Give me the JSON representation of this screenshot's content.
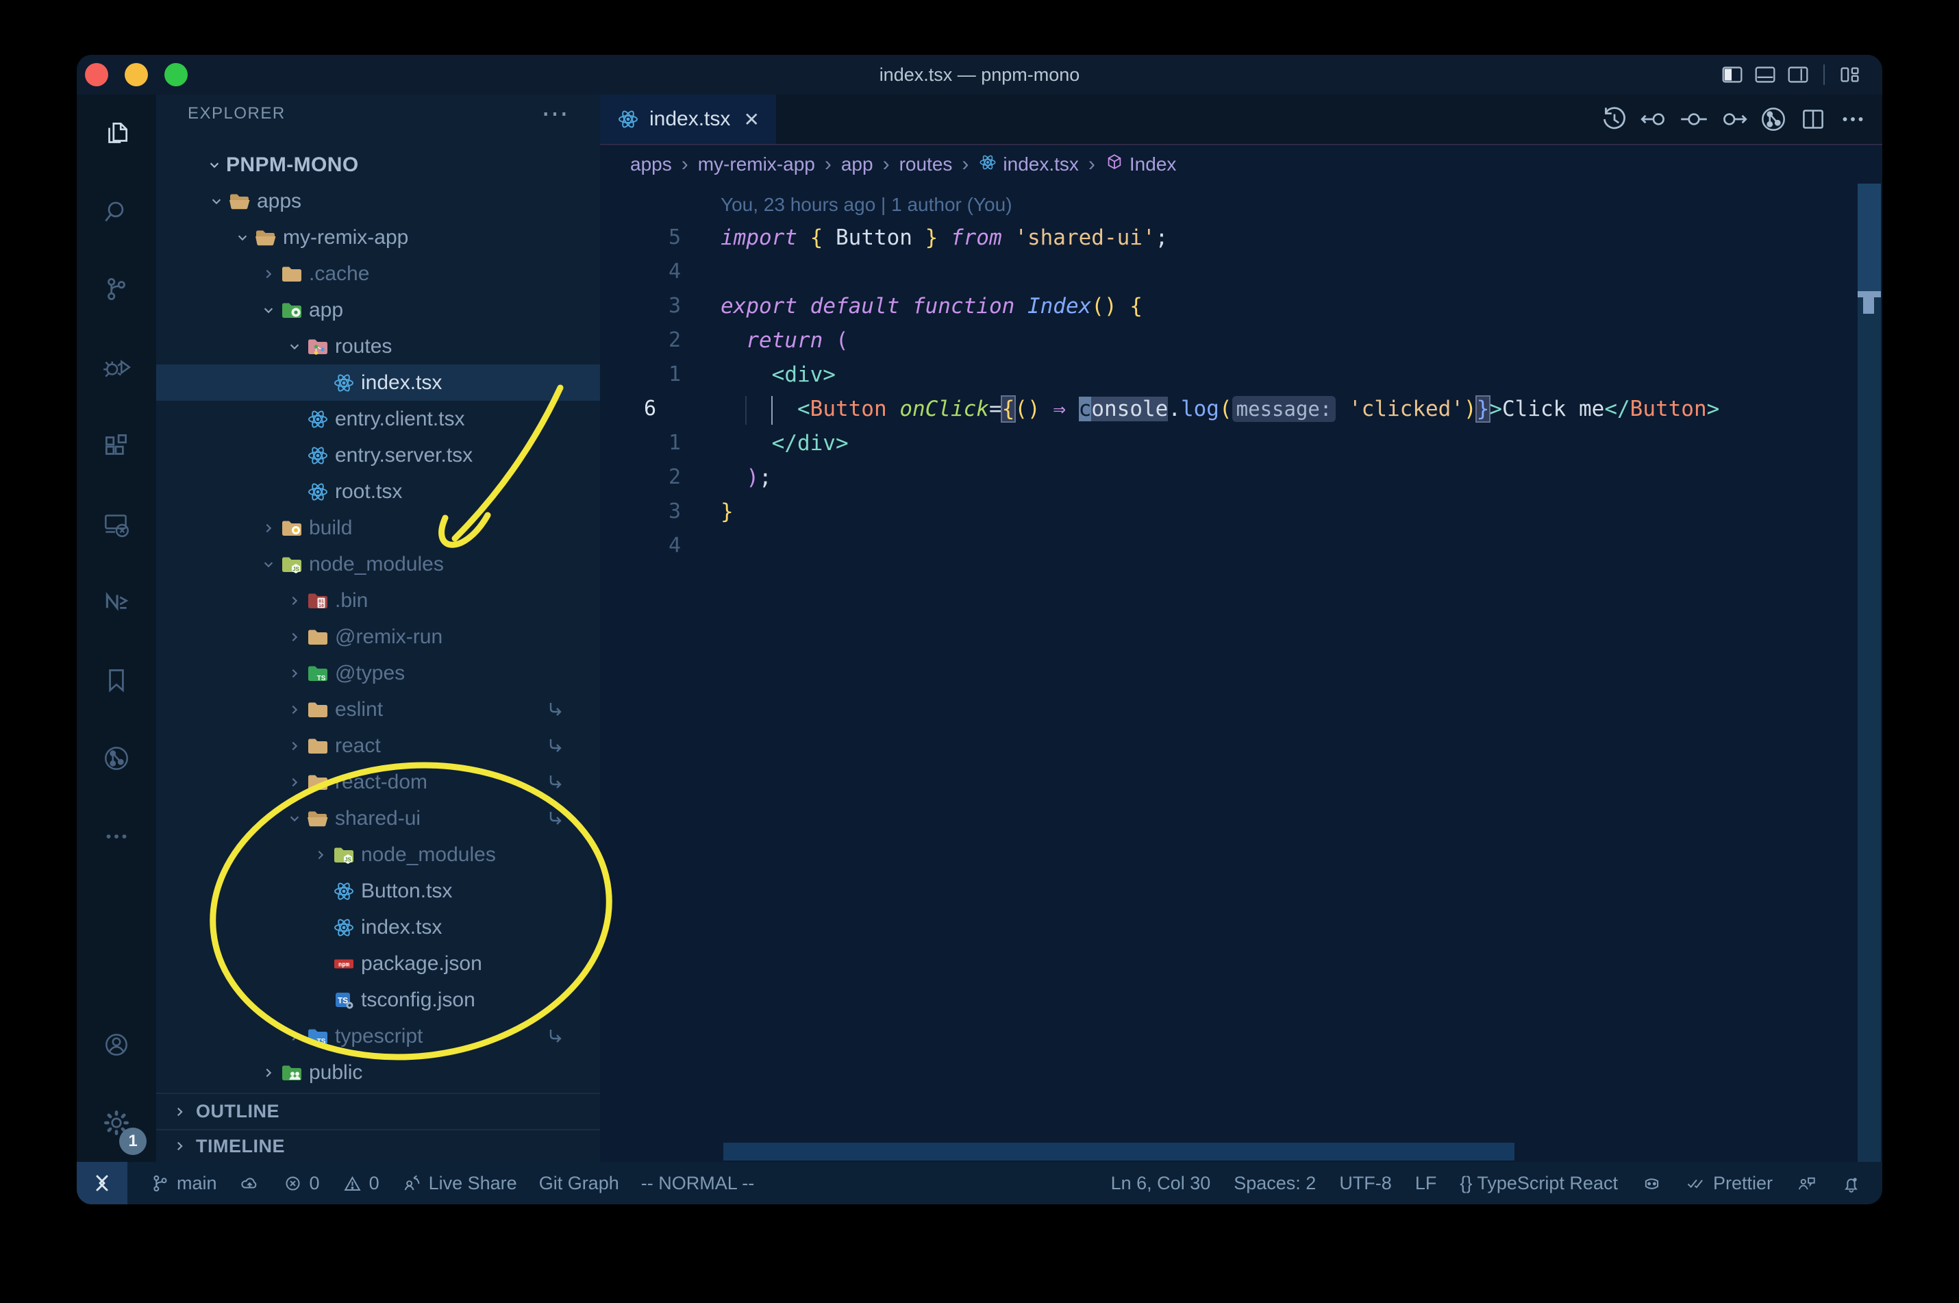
{
  "window": {
    "title": "index.tsx — pnpm-mono",
    "controls": [
      {
        "name": "close",
        "color": "#f5605a"
      },
      {
        "name": "minimize",
        "color": "#f6bd3e"
      },
      {
        "name": "zoom",
        "color": "#31c748"
      }
    ],
    "layout_icons": [
      "panel-left",
      "panel-bottom",
      "panel-right",
      "|",
      "layout"
    ]
  },
  "activity_bar": {
    "top": [
      {
        "name": "explorer",
        "icon": "files",
        "active": true
      },
      {
        "name": "search",
        "icon": "search"
      },
      {
        "name": "source-control",
        "icon": "scm"
      },
      {
        "name": "run-and-debug",
        "icon": "debug"
      },
      {
        "name": "extensions",
        "icon": "extensions"
      },
      {
        "name": "remote-explorer",
        "icon": "remote"
      },
      {
        "name": "nx-console",
        "icon": "nx"
      },
      {
        "name": "bookmarks",
        "icon": "bookmark"
      },
      {
        "name": "git-graph",
        "icon": "gitgraph"
      },
      {
        "name": "more",
        "icon": "ellipsis"
      }
    ],
    "bottom": [
      {
        "name": "accounts",
        "icon": "account"
      },
      {
        "name": "settings",
        "icon": "gear",
        "badge": "1"
      }
    ]
  },
  "explorer": {
    "header": "EXPLORER",
    "actions_glyph": "⋯",
    "sections": [
      "OUTLINE",
      "TIMELINE"
    ],
    "tree": [
      {
        "label": "PNPM-MONO",
        "level": 0,
        "root": true,
        "chev": "open"
      },
      {
        "label": "apps",
        "level": 1,
        "icon": "folder-open",
        "chev": "open"
      },
      {
        "label": "my-remix-app",
        "level": 2,
        "icon": "folder-open",
        "chev": "open"
      },
      {
        "label": ".cache",
        "level": 3,
        "icon": "folder",
        "chev": "closed",
        "dim": true
      },
      {
        "label": "app",
        "level": 3,
        "icon": "folder-app",
        "chev": "open"
      },
      {
        "label": "routes",
        "level": 4,
        "icon": "folder-routes",
        "chev": "open"
      },
      {
        "label": "index.tsx",
        "level": 5,
        "icon": "react",
        "selected": true
      },
      {
        "label": "entry.client.tsx",
        "level": 4,
        "icon": "react"
      },
      {
        "label": "entry.server.tsx",
        "level": 4,
        "icon": "react"
      },
      {
        "label": "root.tsx",
        "level": 4,
        "icon": "react"
      },
      {
        "label": "build",
        "level": 3,
        "icon": "folder-build",
        "chev": "closed",
        "dim": true
      },
      {
        "label": "node_modules",
        "level": 3,
        "icon": "folder-nm",
        "chev": "open",
        "dim": true
      },
      {
        "label": ".bin",
        "level": 4,
        "icon": "folder-bin",
        "chev": "closed",
        "dim": true
      },
      {
        "label": "@remix-run",
        "level": 4,
        "icon": "folder",
        "chev": "closed",
        "dim": true
      },
      {
        "label": "@types",
        "level": 4,
        "icon": "folder-types",
        "chev": "closed",
        "dim": true
      },
      {
        "label": "eslint",
        "level": 4,
        "icon": "folder",
        "chev": "closed",
        "dim": true,
        "symlink": true
      },
      {
        "label": "react",
        "level": 4,
        "icon": "folder",
        "chev": "closed",
        "dim": true,
        "symlink": true
      },
      {
        "label": "react-dom",
        "level": 4,
        "icon": "folder",
        "chev": "closed",
        "dim": true,
        "symlink": true
      },
      {
        "label": "shared-ui",
        "level": 4,
        "icon": "folder-open",
        "chev": "open",
        "dim": true,
        "symlink": true
      },
      {
        "label": "node_modules",
        "level": 5,
        "icon": "folder-nm",
        "chev": "closed",
        "dim": true
      },
      {
        "label": "Button.tsx",
        "level": 5,
        "icon": "react"
      },
      {
        "label": "index.tsx",
        "level": 5,
        "icon": "react"
      },
      {
        "label": "package.json",
        "level": 5,
        "icon": "npm"
      },
      {
        "label": "tsconfig.json",
        "level": 5,
        "icon": "tsconfig"
      },
      {
        "label": "typescript",
        "level": 4,
        "icon": "folder-ts",
        "chev": "closed",
        "dim": true,
        "symlink": true
      },
      {
        "label": "public",
        "level": 3,
        "icon": "folder-public",
        "chev": "closed"
      }
    ]
  },
  "editor": {
    "tab": {
      "label": "index.tsx",
      "icon": "react",
      "close_glyph": "✕"
    },
    "toolbar": [
      "history",
      "commit-prev",
      "commit",
      "commit-next",
      "gitgraph",
      "split",
      "ellipsis"
    ],
    "breadcrumbs": [
      {
        "label": "apps"
      },
      {
        "label": "my-remix-app"
      },
      {
        "label": "app"
      },
      {
        "label": "routes"
      },
      {
        "label": "index.tsx",
        "icon": "react"
      },
      {
        "label": "Index",
        "icon": "cube"
      }
    ],
    "blame": "You, 23 hours ago | 1 author (You)",
    "lines": [
      {
        "num": "5",
        "tokens": [
          [
            "kw",
            "import"
          ],
          [
            "pl",
            " "
          ],
          [
            "y",
            "{"
          ],
          [
            "pl",
            " Button "
          ],
          [
            "y",
            "}"
          ],
          [
            "pl",
            " "
          ],
          [
            "kw",
            "from"
          ],
          [
            "pl",
            " "
          ],
          [
            "str",
            "'shared-ui'"
          ],
          [
            "pl",
            ";"
          ]
        ]
      },
      {
        "num": "4",
        "tokens": []
      },
      {
        "num": "3",
        "tokens": [
          [
            "kw",
            "export"
          ],
          [
            "pl",
            " "
          ],
          [
            "kw",
            "default"
          ],
          [
            "pl",
            " "
          ],
          [
            "kw",
            "function"
          ],
          [
            "pl",
            " "
          ],
          [
            "fn",
            "Index"
          ],
          [
            "y",
            "()"
          ],
          [
            "pl",
            " "
          ],
          [
            "y",
            "{"
          ]
        ]
      },
      {
        "num": "2",
        "tokens": [
          [
            "pl",
            "  "
          ],
          [
            "kw",
            "return"
          ],
          [
            "pl",
            " "
          ],
          [
            "mag",
            "("
          ]
        ]
      },
      {
        "num": "1",
        "tokens": [
          [
            "pl",
            "    "
          ],
          [
            "teal",
            "<div>"
          ]
        ]
      },
      {
        "num": "6",
        "current": true,
        "tokens": [
          [
            "pl",
            "  "
          ],
          [
            "gf",
            ""
          ],
          [
            "pl",
            "  "
          ],
          [
            "guide",
            ""
          ],
          [
            "pl",
            "  "
          ],
          [
            "teal",
            "<"
          ],
          [
            "coral",
            "Button"
          ],
          [
            "pl",
            " "
          ],
          [
            "attr",
            "onClick"
          ],
          [
            "pl",
            "="
          ],
          [
            "ybox",
            "{"
          ],
          [
            "y",
            "()"
          ],
          [
            "pl",
            " "
          ],
          [
            "arrow",
            "⇒"
          ],
          [
            "pl",
            " "
          ],
          [
            "cur",
            "c"
          ],
          [
            "whl",
            "onsole"
          ],
          [
            "pl",
            "."
          ],
          [
            "fnb",
            "log"
          ],
          [
            "y",
            "("
          ],
          [
            "inlay",
            "message:"
          ],
          [
            "pl",
            " "
          ],
          [
            "str",
            "'clicked'"
          ],
          [
            "y",
            ")"
          ],
          [
            "bbox",
            "}"
          ],
          [
            "teal",
            ">"
          ],
          [
            "pl",
            "Click me"
          ],
          [
            "teal",
            "</"
          ],
          [
            "coral",
            "Button"
          ],
          [
            "teal",
            ">"
          ]
        ]
      },
      {
        "num": "1",
        "tokens": [
          [
            "pl",
            "    "
          ],
          [
            "teal",
            "</div>"
          ]
        ]
      },
      {
        "num": "2",
        "tokens": [
          [
            "pl",
            "  "
          ],
          [
            "mag",
            ")"
          ],
          [
            "pl",
            ";"
          ]
        ]
      },
      {
        "num": "3",
        "tokens": [
          [
            "y",
            "}"
          ]
        ]
      },
      {
        "num": "4",
        "tokens": []
      }
    ]
  },
  "status_bar": {
    "left": [
      {
        "name": "branch",
        "icon": "branch",
        "label": "main"
      },
      {
        "name": "sync",
        "icon": "cloud",
        "label": ""
      },
      {
        "name": "errors",
        "icon": "error",
        "label": "0"
      },
      {
        "name": "warnings",
        "icon": "warning",
        "label": "0"
      },
      {
        "name": "live-share",
        "icon": "liveshare",
        "label": "Live Share"
      },
      {
        "name": "git-graph",
        "label": "Git Graph"
      },
      {
        "name": "vim-mode",
        "label": "-- NORMAL --"
      }
    ],
    "right": [
      {
        "name": "cursor-position",
        "label": "Ln 6, Col 30"
      },
      {
        "name": "indentation",
        "label": "Spaces: 2"
      },
      {
        "name": "encoding",
        "label": "UTF-8"
      },
      {
        "name": "eol",
        "label": "LF"
      },
      {
        "name": "language-mode",
        "label": "{} TypeScript React"
      },
      {
        "name": "copilot",
        "icon": "copilot",
        "label": ""
      },
      {
        "name": "prettier",
        "icon": "dblcheck",
        "label": "Prettier"
      },
      {
        "name": "feedback",
        "icon": "feedback",
        "label": ""
      },
      {
        "name": "notifications",
        "icon": "bell",
        "label": ""
      }
    ]
  },
  "annotations": {
    "color": "#f2e73b",
    "notes": [
      "hand-drawn arrow pointing at node_modules",
      "hand-drawn ellipse around shared-ui package contents"
    ]
  }
}
